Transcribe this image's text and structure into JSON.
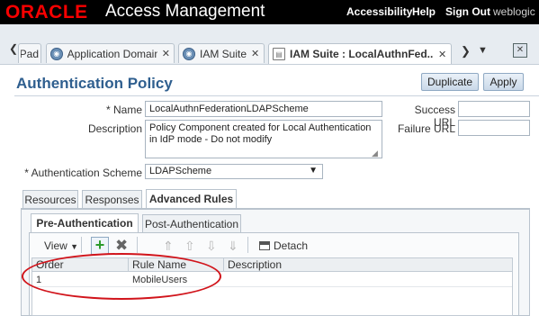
{
  "header": {
    "logo": "ORACLE",
    "title": "Access Management",
    "links": [
      "Accessibility",
      "Help",
      "Sign Out"
    ],
    "user": "weblogic"
  },
  "tabs": {
    "partial": "Pad",
    "items": [
      {
        "label": "Application Domain",
        "icon": "globe-icon"
      },
      {
        "label": "IAM Suite",
        "icon": "globe-icon"
      },
      {
        "label": "IAM Suite : LocalAuthnFed...",
        "icon": "document-icon",
        "active": true
      }
    ]
  },
  "panel": {
    "title": "Authentication Policy",
    "duplicate_label": "Duplicate",
    "apply_label": "Apply"
  },
  "form": {
    "name_label": "* Name",
    "name_value": "LocalAuthnFederationLDAPScheme",
    "description_label": "Description",
    "description_value": "Policy Component created for Local Authentication in IdP mode - Do not modify",
    "scheme_label": "* Authentication Scheme",
    "scheme_value": "LDAPScheme",
    "success_url_label": "Success URL",
    "failure_url_label": "Failure URL"
  },
  "section_tabs": [
    "Resources",
    "Responses",
    "Advanced Rules"
  ],
  "rule_tabs": [
    "Pre-Authentication",
    "Post-Authentication"
  ],
  "toolbar": {
    "view_label": "View",
    "detach_label": "Detach"
  },
  "table": {
    "columns": [
      "Order",
      "Rule Name",
      "Description"
    ],
    "rows": [
      {
        "order": "1",
        "rule_name": "MobileUsers",
        "description": ""
      }
    ]
  },
  "colors": {
    "brand_red": "#f80000",
    "title_blue": "#2f5f8f",
    "annotation_oval": "#d1141b"
  }
}
